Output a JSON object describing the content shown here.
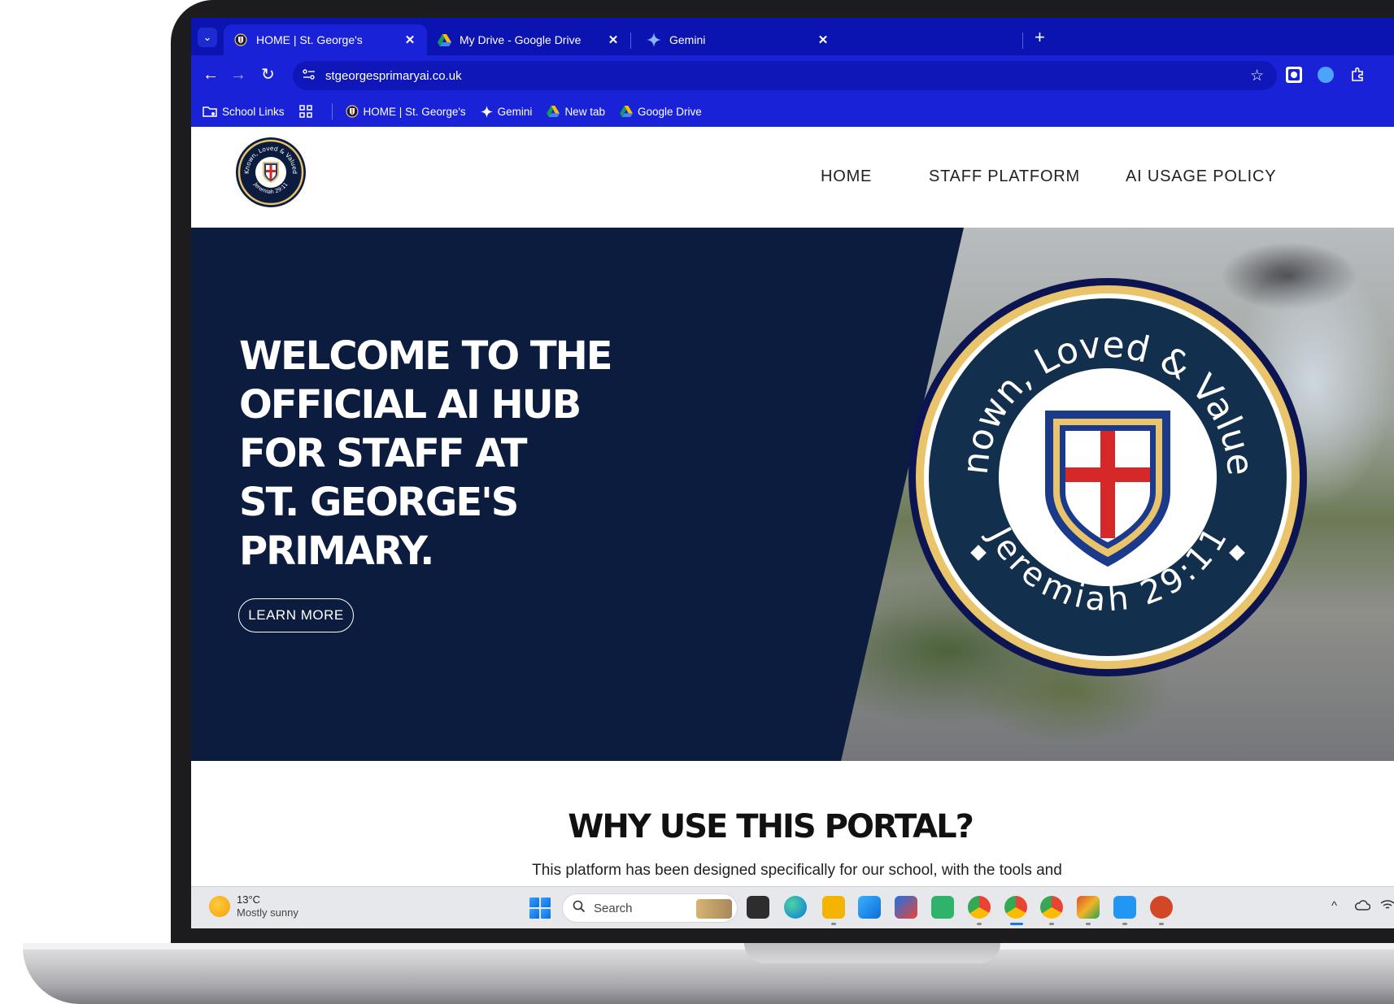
{
  "browser": {
    "tabs": [
      {
        "title": "HOME | St. George's",
        "active": true,
        "favicon": "school-crest-icon"
      },
      {
        "title": "My Drive - Google Drive",
        "active": false,
        "favicon": "google-drive-icon"
      },
      {
        "title": "Gemini",
        "active": false,
        "favicon": "gemini-sparkle-icon"
      }
    ],
    "close_glyph": "✕",
    "new_tab_glyph": "+",
    "tab_menu_glyph": "⌄",
    "url": "stgeorgesprimaryai.co.uk",
    "nav": {
      "back": "←",
      "forward": "→",
      "reload": "↻"
    },
    "star_glyph": "☆",
    "bookmarks": [
      {
        "label": "School Links",
        "icon": "folder-settings-icon"
      },
      {
        "label": "",
        "icon": "apps-grid-icon"
      },
      {
        "label": "HOME | St. George's",
        "icon": "school-crest-icon"
      },
      {
        "label": "Gemini",
        "icon": "gemini-sparkle-icon"
      },
      {
        "label": "New tab",
        "icon": "google-drive-icon"
      },
      {
        "label": "Google Drive",
        "icon": "google-drive-icon"
      }
    ]
  },
  "site": {
    "nav": [
      "HOME",
      "STAFF PLATFORM",
      "AI USAGE POLICY"
    ],
    "crest": {
      "motto": "Known, Loved & Valued",
      "verse": "Jeremiah 29:11"
    },
    "hero": {
      "lines": [
        "WELCOME TO THE",
        "OFFICIAL AI HUB",
        "FOR STAFF AT",
        "ST. GEORGE'S",
        "PRIMARY."
      ],
      "button": "LEARN MORE"
    },
    "why": {
      "title": "WHY USE THIS PORTAL?",
      "text": "This platform has been designed specifically for our school, with the tools and"
    }
  },
  "taskbar": {
    "temperature": "13°C",
    "condition": "Mostly sunny",
    "search_placeholder": "Search",
    "tray_chevron": "^"
  },
  "colors": {
    "browser_chrome": "#1a22d8",
    "hero_navy": "#0c1c3e",
    "crest_gold": "#e9c46a",
    "crest_red": "#d62828"
  }
}
